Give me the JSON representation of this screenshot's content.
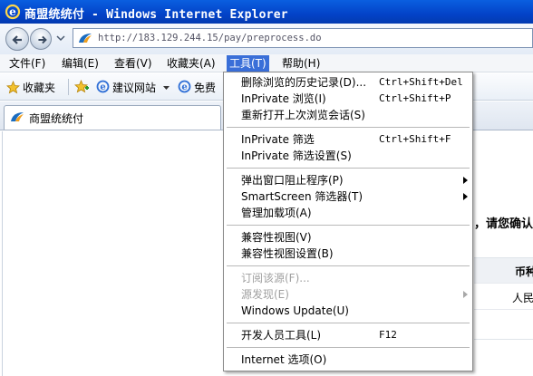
{
  "window": {
    "title": "商盟统统付 - Windows Internet Explorer"
  },
  "address_bar": {
    "url": "http://183.129.244.15/pay/preprocess.do"
  },
  "menu_bar": {
    "items": [
      {
        "label": "文件(F)"
      },
      {
        "label": "编辑(E)"
      },
      {
        "label": "查看(V)"
      },
      {
        "label": "收藏夹(A)"
      },
      {
        "label": "工具(T)",
        "active": true
      },
      {
        "label": "帮助(H)"
      }
    ]
  },
  "favorites_bar": {
    "favorites_label": "收藏夹",
    "suggested_sites_label": "建议网站",
    "free_label": "免费"
  },
  "tab": {
    "label": "商盟统统付"
  },
  "page": {
    "confirm_text": "，请您确认",
    "table_header": "币种",
    "table_cell": "人民"
  },
  "tools_menu": {
    "items": [
      {
        "label": "删除浏览的历史记录(D)...",
        "shortcut": "Ctrl+Shift+Del",
        "submenu": false,
        "disabled": false
      },
      {
        "label": "InPrivate 浏览(I)",
        "shortcut": "Ctrl+Shift+P",
        "submenu": false,
        "disabled": false
      },
      {
        "label": "重新打开上次浏览会话(S)",
        "shortcut": "",
        "submenu": false,
        "disabled": false
      },
      {
        "label": "InPrivate 筛选",
        "shortcut": "Ctrl+Shift+F",
        "submenu": false,
        "disabled": false
      },
      {
        "label": "InPrivate 筛选设置(S)",
        "shortcut": "",
        "submenu": false,
        "disabled": false
      },
      {
        "label": "弹出窗口阻止程序(P)",
        "shortcut": "",
        "submenu": true,
        "disabled": false
      },
      {
        "label": "SmartScreen 筛选器(T)",
        "shortcut": "",
        "submenu": true,
        "disabled": false
      },
      {
        "label": "管理加载项(A)",
        "shortcut": "",
        "submenu": false,
        "disabled": false
      },
      {
        "label": "兼容性视图(V)",
        "shortcut": "",
        "submenu": false,
        "disabled": false
      },
      {
        "label": "兼容性视图设置(B)",
        "shortcut": "",
        "submenu": false,
        "disabled": false
      },
      {
        "label": "订阅该源(F)...",
        "shortcut": "",
        "submenu": false,
        "disabled": true
      },
      {
        "label": "源发现(E)",
        "shortcut": "",
        "submenu": true,
        "disabled": true
      },
      {
        "label": "Windows Update(U)",
        "shortcut": "",
        "submenu": false,
        "disabled": false
      },
      {
        "label": "开发人员工具(L)",
        "shortcut": "F12",
        "submenu": false,
        "disabled": false
      },
      {
        "label": "Internet 选项(O)",
        "shortcut": "",
        "submenu": false,
        "disabled": false
      }
    ]
  },
  "colors": {
    "titlebar": "#0343c8",
    "menu_highlight": "#3a6fd8",
    "disabled_text": "#a0a0a0"
  }
}
